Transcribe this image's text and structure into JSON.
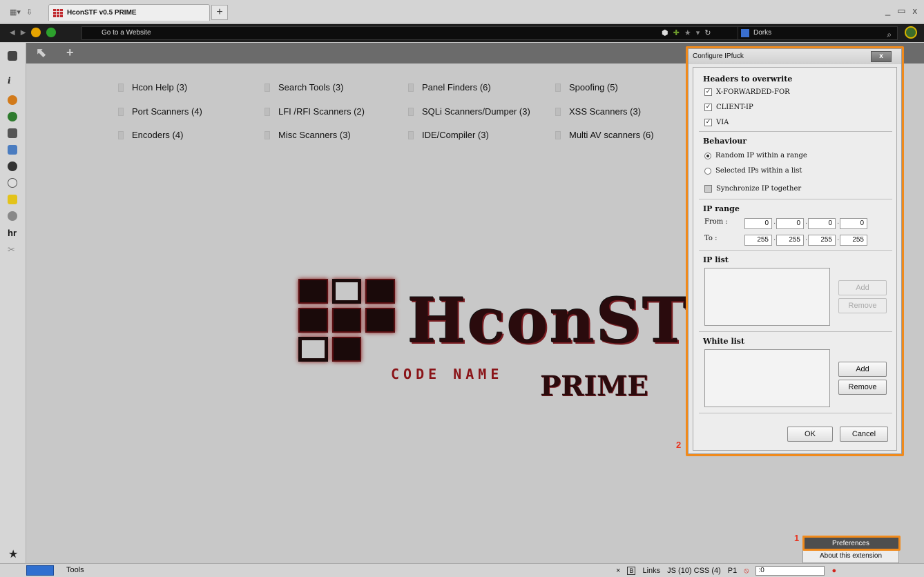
{
  "window": {
    "tab_title": "HconSTF v0.5 PRIME",
    "new_tab": "+",
    "controls": [
      "_",
      "▭",
      "x"
    ]
  },
  "navbar": {
    "url_placeholder": "Go to a Website",
    "search_engine": "Dorks"
  },
  "categories": [
    {
      "label": "Hcon Help (3)"
    },
    {
      "label": "Search Tools (3)"
    },
    {
      "label": "Panel Finders (6)"
    },
    {
      "label": "Spoofing (5)"
    },
    {
      "label": "Port Scanners (4)"
    },
    {
      "label": "LFI /RFI Scanners (2)"
    },
    {
      "label": "SQLi Scanners/Dumper (3)"
    },
    {
      "label": "XSS Scanners (3)"
    },
    {
      "label": "Encoders (4)"
    },
    {
      "label": "Misc Scanners (3)"
    },
    {
      "label": "IDE/Compiler (3)"
    },
    {
      "label": "Multi AV scanners (6)"
    }
  ],
  "logo": {
    "main": "HconSTF",
    "sub": "CODE NAME",
    "prime": "PRIME"
  },
  "dialog": {
    "title": "Configure IPfuck",
    "close": "x",
    "headers_title": "Headers to overwrite",
    "headers": [
      {
        "label": "X-FORWARDED-FOR",
        "checked": true
      },
      {
        "label": "CLIENT-IP",
        "checked": true
      },
      {
        "label": "VIA",
        "checked": true
      }
    ],
    "behaviour_title": "Behaviour",
    "behaviour_options": [
      {
        "label": "Random IP within a range",
        "selected": true
      },
      {
        "label": "Selected IPs within a list",
        "selected": false
      }
    ],
    "sync_label": "Synchronize IP together",
    "sync_checked": false,
    "ip_range_title": "IP range",
    "from_label": "From :",
    "to_label": "To :",
    "from_values": [
      "0",
      "0",
      "0",
      "0"
    ],
    "to_values": [
      "255",
      "255",
      "255",
      "255"
    ],
    "ip_list_title": "IP list",
    "ip_list_add": "Add",
    "ip_list_remove": "Remove",
    "white_list_title": "White list",
    "white_list_add": "Add",
    "white_list_remove": "Remove",
    "ok": "OK",
    "cancel": "Cancel"
  },
  "markers": {
    "one": "1",
    "two": "2"
  },
  "popup": {
    "preferences": "Preferences",
    "about": "About this extension"
  },
  "statusbar": {
    "tools": "Tools",
    "close": "×",
    "links": "Links",
    "js_css": "JS (10) CSS (4)",
    "p1": "P1",
    "input_value": ":0"
  },
  "colors": {
    "highlight": "#f08a1c",
    "marker": "#e8331f",
    "logo_red": "#8a1418"
  }
}
